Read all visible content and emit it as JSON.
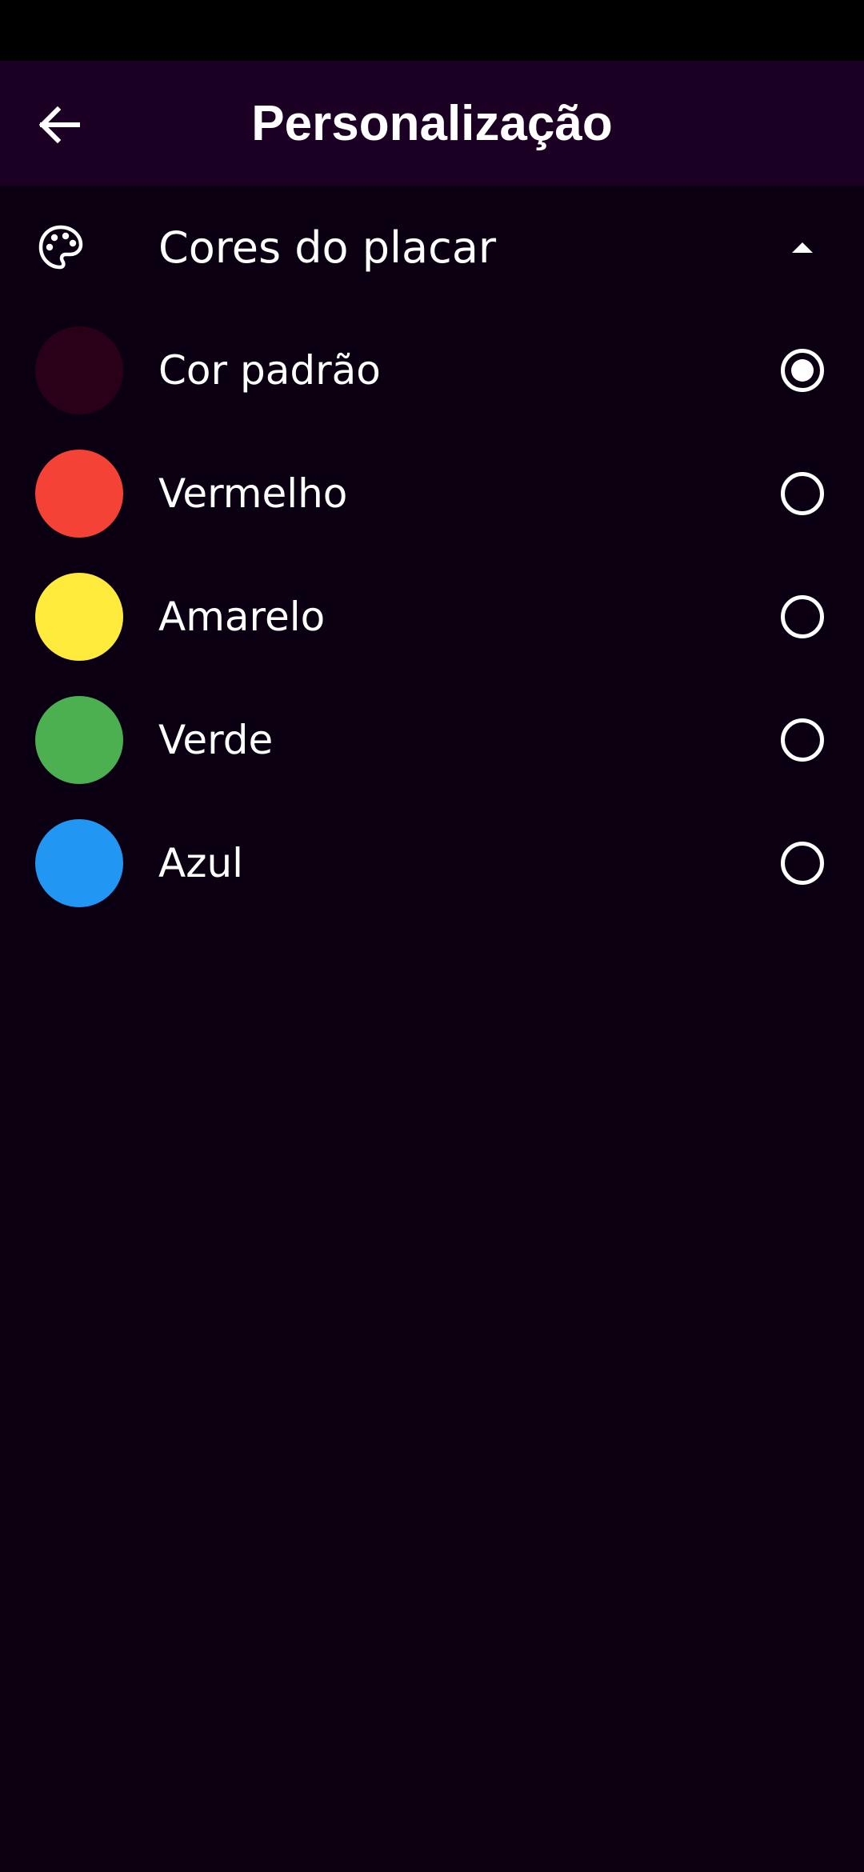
{
  "header": {
    "title": "Personalização",
    "back_icon": "arrow-left-icon"
  },
  "section": {
    "icon": "palette-icon",
    "title": "Cores do placar",
    "expanded": true,
    "toggle_icon": "caret-up-icon"
  },
  "options": [
    {
      "label": "Cor padrão",
      "color": "#2a0018",
      "selected": true
    },
    {
      "label": "Vermelho",
      "color": "#f44336",
      "selected": false
    },
    {
      "label": "Amarelo",
      "color": "#ffeb3b",
      "selected": false
    },
    {
      "label": "Verde",
      "color": "#4caf50",
      "selected": false
    },
    {
      "label": "Azul",
      "color": "#2196f3",
      "selected": false
    }
  ],
  "colors": {
    "background": "#0b0012",
    "app_bar": "#1c0024",
    "status_bar": "#000000",
    "foreground": "#ffffff"
  }
}
